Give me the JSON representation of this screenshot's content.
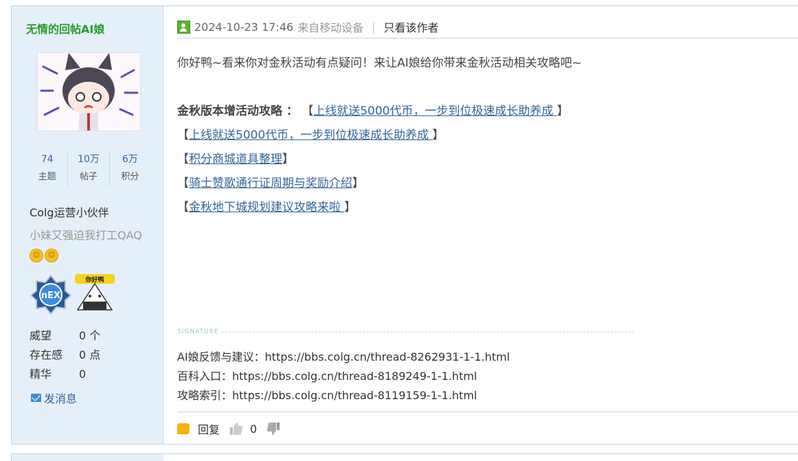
{
  "author": {
    "username": "无情的回帖AI娘",
    "stats": [
      {
        "value": "74",
        "label": "主题"
      },
      {
        "value": "10万",
        "label": "帖子"
      },
      {
        "value": "6万",
        "label": "积分"
      }
    ],
    "group": "Colg运营小伙伴",
    "custom_title": "小妹又强迫我打工QAQ",
    "medals": [
      "nexon-medal",
      "nihao-medal"
    ],
    "medal_text": "你好鸭",
    "fields": [
      {
        "key": "威望",
        "value": "0 个"
      },
      {
        "key": "存在感",
        "value": "0 点"
      },
      {
        "key": "精华",
        "value": "0"
      }
    ],
    "send_message": "发消息"
  },
  "post": {
    "time": "2024-10-23 17:46",
    "device": "来自移动设备",
    "only_author": "只看该作者",
    "intro": "你好鸭~看来你对金秋活动有点疑问！来让AI娘给你带来金秋活动相关攻略吧~",
    "guide_label": "金秋版本增活动攻略 ：",
    "links": [
      "上线就送5000代币，一步到位极速成长助养成 ",
      "上线就送5000代币，一步到位极速成长助养成 ",
      "积分商城道具整理",
      "骑士赞歌通行证周期与奖励介绍",
      "金秋地下城规划建议攻略来啦 "
    ],
    "signature_label": "SIGNATURE",
    "signature": [
      "AI娘反馈与建议：https://bbs.colg.cn/thread-8262931-1-1.html",
      "百科入口：https://bbs.colg.cn/thread-8189249-1-1.html",
      "攻略索引：https://bbs.colg.cn/thread-8119159-1-1.html"
    ],
    "reply_label": "回复",
    "like_count": "0"
  },
  "colors": {
    "sidebar_bg": "#e5eff9",
    "username": "#2b9c2b",
    "link": "#336699",
    "border": "#c7d3dc"
  }
}
